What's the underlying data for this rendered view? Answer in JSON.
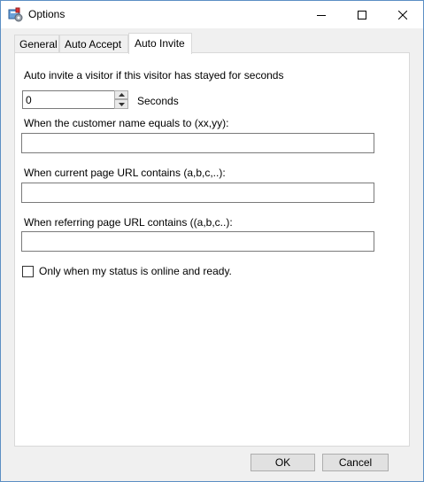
{
  "window": {
    "title": "Options",
    "minimize_icon": "minimize-icon",
    "maximize_icon": "maximize-icon",
    "close_icon": "close-icon",
    "app_icon": "options-app-icon"
  },
  "tabs": [
    {
      "label": "General"
    },
    {
      "label": "Auto Accept"
    },
    {
      "label": "Auto Invite",
      "selected": true
    }
  ],
  "form": {
    "stay_label": "Auto invite a visitor if this visitor has stayed for seconds",
    "seconds_value": "0",
    "seconds_unit": "Seconds",
    "customer_name_label": "When the customer name equals to (xx,yy):",
    "customer_name_value": "",
    "current_url_label": "When current page URL contains (a,b,c,..):",
    "current_url_value": "",
    "referring_url_label": "When referring page URL contains ((a,b,c..):",
    "referring_url_value": "",
    "online_checkbox_label": "Only when my status is online and ready.",
    "online_checked": false
  },
  "buttons": {
    "ok": "OK",
    "cancel": "Cancel"
  }
}
